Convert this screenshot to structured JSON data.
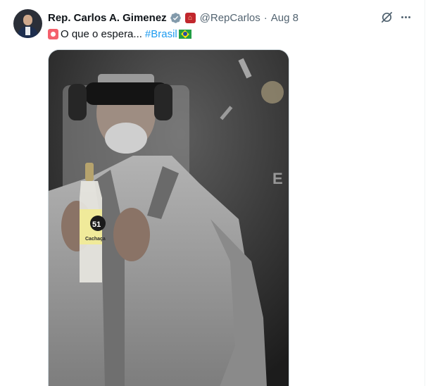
{
  "tweet": {
    "display_name": "Rep. Carlos A. Gimenez",
    "handle": "@RepCarlos",
    "separator": "·",
    "time": "Aug 8",
    "text_before_hashtag": "O que o espera...",
    "hashtag": "#Brasil",
    "icons": {
      "verified": "verified-badge-icon",
      "affiliation": "house-seal-icon",
      "siren": "rotating-light-emoji",
      "flag": "brazil-flag-emoji",
      "grok": "grok-icon",
      "more": "more-icon"
    }
  },
  "media": {
    "bottle_label_number": "51",
    "bottle_label_text": "Cachaça",
    "description_icon": "photo-of-man-with-blindfold-and-headphones-holding-bottle"
  },
  "colors": {
    "accent": "#1d9bf0",
    "text": "#0f1419",
    "muted": "#536471",
    "border": "#cfd9de"
  }
}
